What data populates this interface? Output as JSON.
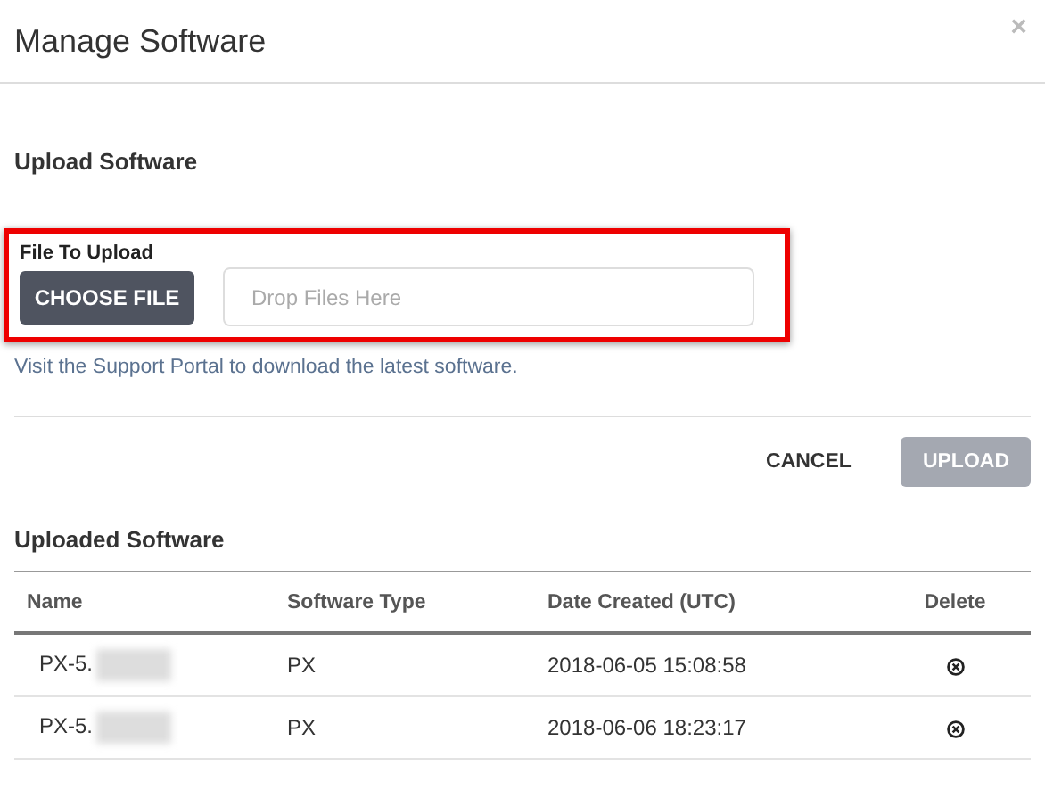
{
  "dialog": {
    "title": "Manage Software",
    "close": "×"
  },
  "upload_section": {
    "heading": "Upload Software",
    "highlighted": true,
    "field_label": "File To Upload",
    "choose_button": "CHOOSE FILE",
    "drop_placeholder": "Drop Files Here",
    "link": "Visit the Support Portal to download the latest software."
  },
  "actions": [
    {
      "label": "CANCEL",
      "kind": "text",
      "disabled": false
    },
    {
      "label": "UPLOAD",
      "kind": "filled",
      "disabled": true
    }
  ],
  "uploaded": {
    "heading": "Uploaded Software",
    "columns": [
      "Name",
      "Software Type",
      "Date Created (UTC)",
      "Delete"
    ],
    "rows": [
      {
        "name": "PX-5.",
        "redacted": true,
        "type": "PX",
        "date": "2018-06-05 15:08:58"
      },
      {
        "name": "PX-5.",
        "redacted": true,
        "type": "PX",
        "date": "2018-06-06 18:23:17"
      }
    ]
  }
}
